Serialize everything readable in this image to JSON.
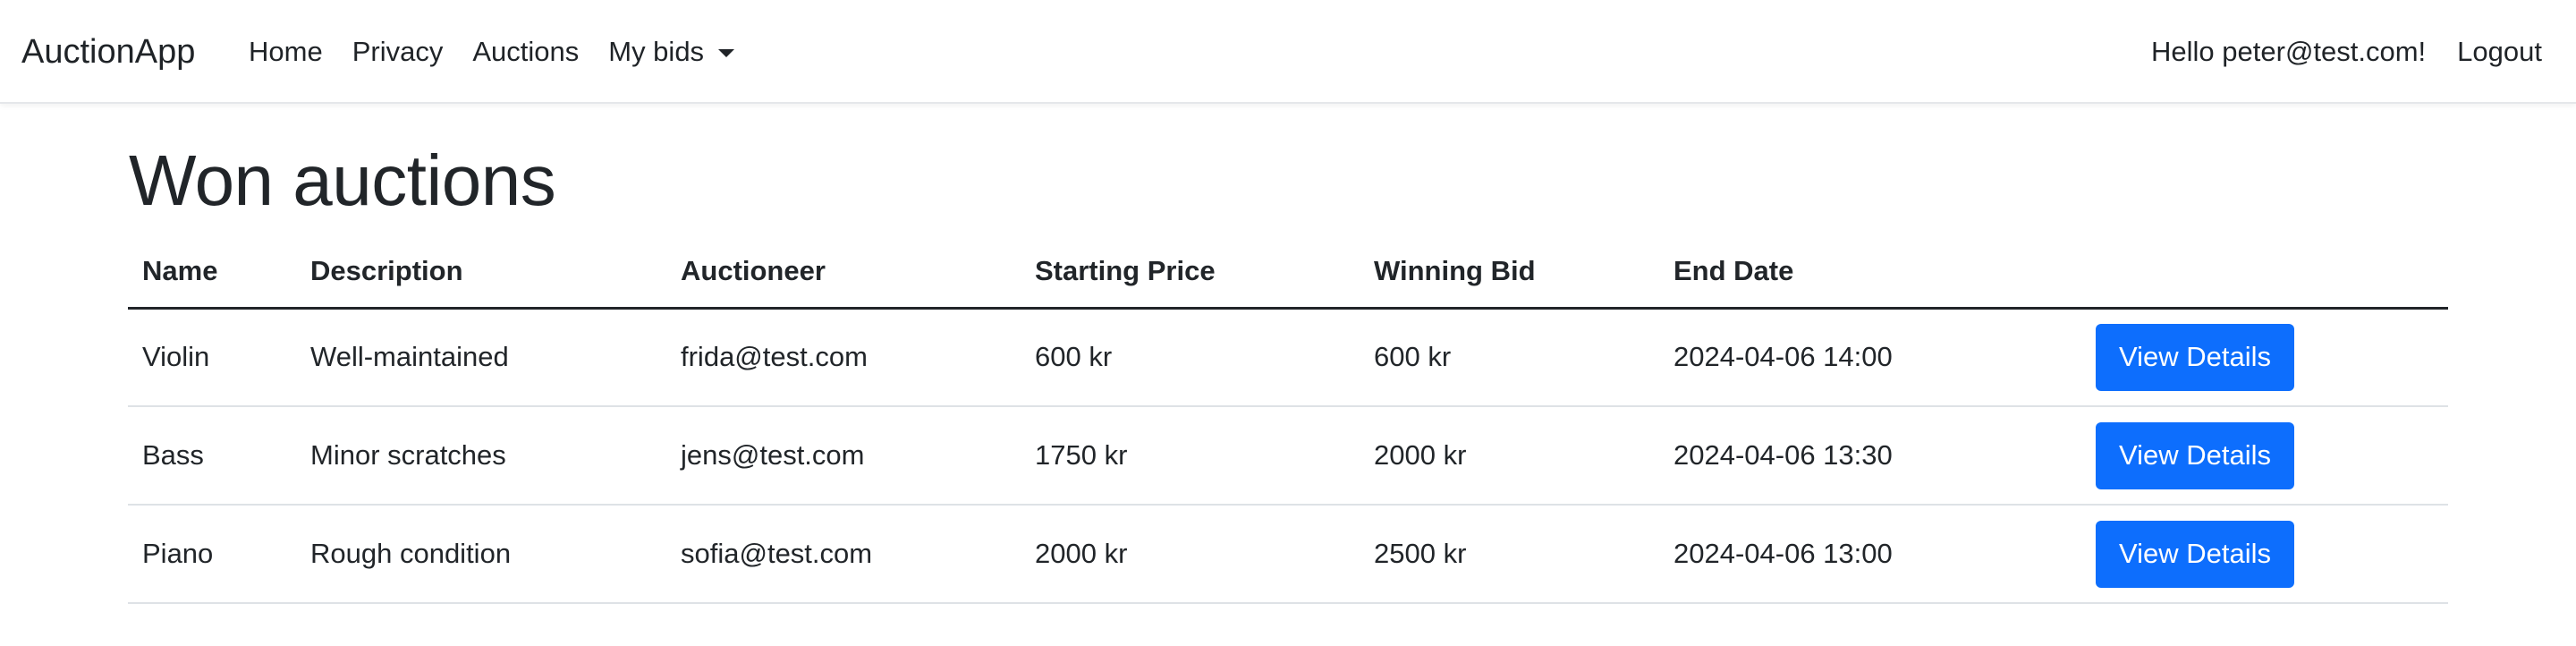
{
  "navbar": {
    "brand": "AuctionApp",
    "links": [
      {
        "label": "Home"
      },
      {
        "label": "Privacy"
      },
      {
        "label": "Auctions"
      }
    ],
    "dropdown_label": "My bids",
    "greeting": "Hello peter@test.com!",
    "logout_label": "Logout"
  },
  "page": {
    "title": "Won auctions"
  },
  "table": {
    "columns": [
      "Name",
      "Description",
      "Auctioneer",
      "Starting Price",
      "Winning Bid",
      "End Date",
      ""
    ],
    "rows": [
      {
        "name": "Violin",
        "description": "Well-maintained",
        "auctioneer": "frida@test.com",
        "starting_price": "600 kr",
        "winning_bid": "600 kr",
        "end_date": "2024-04-06 14:00",
        "action_label": "View Details"
      },
      {
        "name": "Bass",
        "description": "Minor scratches",
        "auctioneer": "jens@test.com",
        "starting_price": "1750 kr",
        "winning_bid": "2000 kr",
        "end_date": "2024-04-06 13:30",
        "action_label": "View Details"
      },
      {
        "name": "Piano",
        "description": "Rough condition",
        "auctioneer": "sofia@test.com",
        "starting_price": "2000 kr",
        "winning_bid": "2500 kr",
        "end_date": "2024-04-06 13:00",
        "action_label": "View Details"
      }
    ]
  },
  "colors": {
    "primary_button": "#0d6efd",
    "text": "#212529",
    "row_border": "#dee2e6"
  }
}
